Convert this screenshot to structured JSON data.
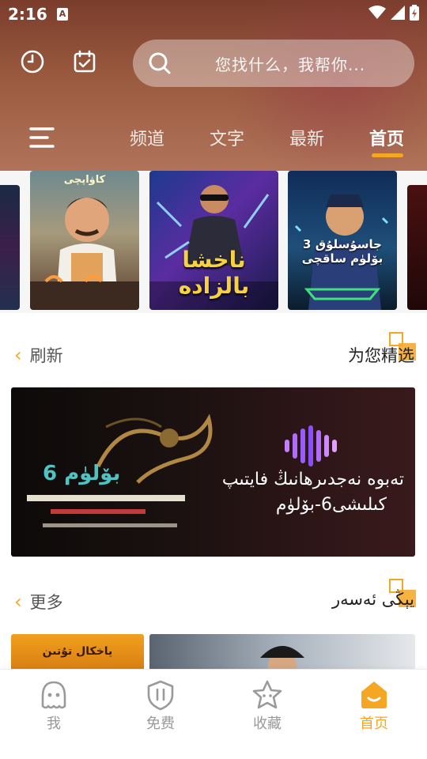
{
  "status_bar": {
    "time": "2:16",
    "notification_badge": "A"
  },
  "search": {
    "placeholder": "您找什么，我帮你..."
  },
  "nav_tabs": [
    {
      "label": "频道",
      "active": false
    },
    {
      "label": "文字",
      "active": false
    },
    {
      "label": "最新",
      "active": false
    },
    {
      "label": "首页",
      "active": true
    }
  ],
  "posters": [
    {
      "title": ""
    },
    {
      "title": "كاۋاپچى"
    },
    {
      "title": "ناخشا بالزادە"
    },
    {
      "title": "3 جاسۇسلۇق بۆلۈم ساقچى"
    },
    {
      "title": ""
    }
  ],
  "section_recommended": {
    "left_label": "刷新",
    "title": "为您精选"
  },
  "banner": {
    "episode_badge": "6 بۆلۈم",
    "line1": "تەبوە نەجدىرھانىڭ فايتىپ",
    "line2": "كىلىشى6-بۆلۈم"
  },
  "section_new": {
    "left_label": "更多",
    "title": "يېڭى ئەسەر"
  },
  "thumbnail_captions": [
    "ياخكال تۇتىن"
  ],
  "bottom_nav": [
    {
      "label": "我",
      "icon": "ghost-icon",
      "active": false
    },
    {
      "label": "免费",
      "icon": "shield-icon",
      "active": false
    },
    {
      "label": "收藏",
      "icon": "star-face-icon",
      "active": false
    },
    {
      "label": "首页",
      "icon": "home-icon",
      "active": true
    }
  ],
  "colors": {
    "accent": "#f5a623",
    "header": "#9a5a3f",
    "inactive": "#999999"
  }
}
